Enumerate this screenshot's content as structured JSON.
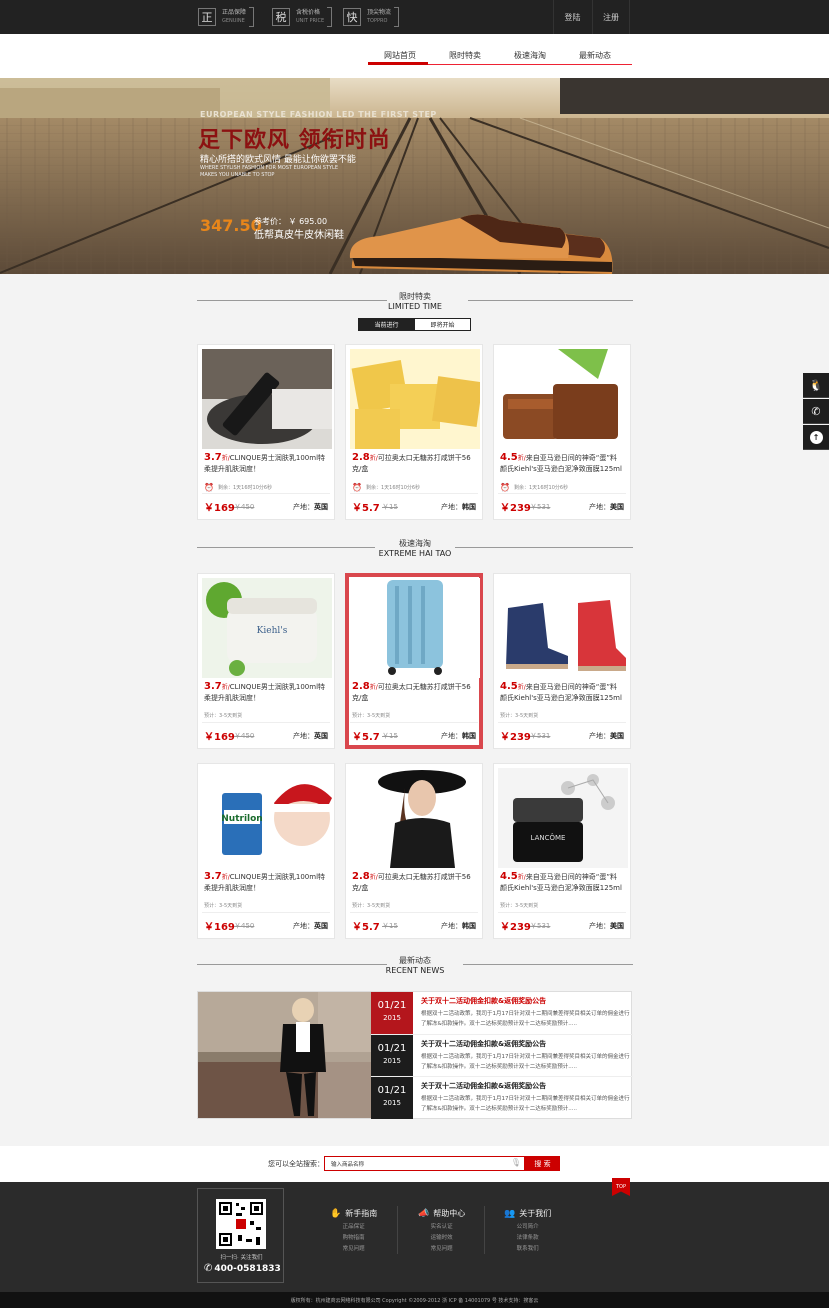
{
  "topbar": {
    "badges": [
      {
        "glyph": "正",
        "cn": "正品保障",
        "en": "GENUINE"
      },
      {
        "glyph": "税",
        "cn": "含税价格",
        "en": "UNIT PRICE"
      },
      {
        "glyph": "快",
        "cn": "顶尖物流",
        "en": "TOPPRO"
      }
    ],
    "login": "登陆",
    "register": "注册"
  },
  "nav": {
    "items": [
      "网站首页",
      "限时特卖",
      "极速海淘",
      "最新动态"
    ]
  },
  "banner": {
    "en_title": "EUROPEAN STYLE FASHION LED THE FIRST STEP",
    "title": "足下欧风 领衔时尚",
    "subtitle": "精心所搭的欧式风情 最能让你欲罢不能",
    "en_sub1": "WHERE STYLISH FASHION FOR MOST EUROPEAN STYLE",
    "en_sub2": "MAKES YOU UNABLE TO STOP",
    "price": "347.50",
    "ref_price": "参考价： ￥ 695.00",
    "product": "低帮真皮牛皮休闲鞋"
  },
  "limited": {
    "cn": "限时特卖",
    "en": "LIMITED TIME",
    "tab_current": "当前进行",
    "tab_upcoming": "即将开始",
    "items": [
      {
        "disc": "3.7",
        "zhe": "折/",
        "title": "CLINQUE男士润肤乳100ml特柔提升肌肤润度！",
        "meta": "剩余：1天16时10分6秒",
        "price": "￥169",
        "old": "￥450",
        "origin_label": "产地：",
        "origin": "英国"
      },
      {
        "disc": "2.8",
        "zhe": "折/",
        "title": "可拉奥太口无糖苏打咸饼干56克/盒",
        "meta": "剩余：1天16时10分6秒",
        "price": "￥5.7",
        "old": "￥15",
        "origin_label": "产地：",
        "origin": "韩国"
      },
      {
        "disc": "4.5",
        "zhe": "折/",
        "title": "来自亚马逊日间的神奇“蛋”料 颜氏Kiehl's亚马逊白泥净致面膜125ml",
        "meta": "剩余：1天16时10分6秒",
        "price": "￥239",
        "old": "￥531",
        "origin_label": "产地：",
        "origin": "美国"
      }
    ]
  },
  "haitao": {
    "cn": "极速海淘",
    "en": "EXTREME HAI TAO",
    "items": [
      {
        "disc": "3.7",
        "zhe": "折/",
        "title": "CLINQUE男士润肤乳100ml特柔提升肌肤润度！",
        "meta": "预计：3-5天到货",
        "price": "￥169",
        "old": "￥450",
        "origin_label": "产地：",
        "origin": "英国"
      },
      {
        "disc": "2.8",
        "zhe": "折/",
        "title": "可拉奥太口无糖苏打咸饼干56克/盒",
        "meta": "预计：3-5天到货",
        "price": "￥5.7",
        "old": "￥15",
        "origin_label": "产地：",
        "origin": "韩国"
      },
      {
        "disc": "4.5",
        "zhe": "折/",
        "title": "来自亚马逊日间的神奇“蛋”料 颜氏Kiehl's亚马逊白泥净致面膜125ml",
        "meta": "预计：3-5天到货",
        "price": "￥239",
        "old": "￥531",
        "origin_label": "产地：",
        "origin": "美国"
      },
      {
        "disc": "3.7",
        "zhe": "折/",
        "title": "CLINQUE男士润肤乳100ml特柔提升肌肤润度！",
        "meta": "预计：3-5天到货",
        "price": "￥169",
        "old": "￥450",
        "origin_label": "产地：",
        "origin": "英国"
      },
      {
        "disc": "2.8",
        "zhe": "折/",
        "title": "可拉奥太口无糖苏打咸饼干56克/盒",
        "meta": "预计：3-5天到货",
        "price": "￥5.7",
        "old": "￥15",
        "origin_label": "产地：",
        "origin": "韩国"
      },
      {
        "disc": "4.5",
        "zhe": "折/",
        "title": "来自亚马逊日间的神奇“蛋”料 颜氏Kiehl's亚马逊白泥净致面膜125ml",
        "meta": "预计：3-5天到货",
        "price": "￥239",
        "old": "￥531",
        "origin_label": "产地：",
        "origin": "美国"
      }
    ]
  },
  "news": {
    "cn": "最新动态",
    "en": "RECENT NEWS",
    "items": [
      {
        "day": "01/21",
        "year": "2015",
        "title": "关于双十二活动佣金扣款&返佣奖励公告",
        "desc": "根据双十二活动政策，我司于1月17日针对双十二期间兼差得奖目相关订单的佣金进行了解冻&扣款操作。双十二达标奖励预计双十二达标奖励预计....."
      },
      {
        "day": "01/21",
        "year": "2015",
        "title": "关于双十二活动佣金扣款&返佣奖励公告",
        "desc": "根据双十二活动政策，我司于1月17日针对双十二期间兼差得奖目相关订单的佣金进行了解冻&扣款操作。双十二达标奖励预计双十二达标奖励预计....."
      },
      {
        "day": "01/21",
        "year": "2015",
        "title": "关于双十二活动佣金扣款&返佣奖励公告",
        "desc": "根据双十二活动政策，我司于1月17日针对双十二期间兼差得奖目相关订单的佣金进行了解冻&扣款操作。双十二达标奖励预计双十二达标奖励预计....."
      }
    ]
  },
  "search": {
    "label": "您可以全站搜索：",
    "placeholder": "输入商品名称",
    "button": "搜 索"
  },
  "footer": {
    "top": "TOP",
    "qr_caption": "扫一扫· 关注我们",
    "phone": "400-0581833",
    "cols": [
      {
        "title": "新手指南",
        "links": [
          "正品保证",
          "购物指南",
          "常见问题"
        ]
      },
      {
        "title": "帮助中心",
        "links": [
          "实名认证",
          "运输时效",
          "常见问题"
        ]
      },
      {
        "title": "关于我们",
        "links": [
          "公司简介",
          "法律条款",
          "联系我们"
        ]
      }
    ],
    "copyright": "版权所有：杭州建商云网络科技有限公司    Copyright ©2009-2012  浙 ICP 备 14001079 号      技术支持：搜客云"
  },
  "colors": {
    "accent": "#c00000",
    "dark": "#222222",
    "active_border": "#d9474d"
  }
}
